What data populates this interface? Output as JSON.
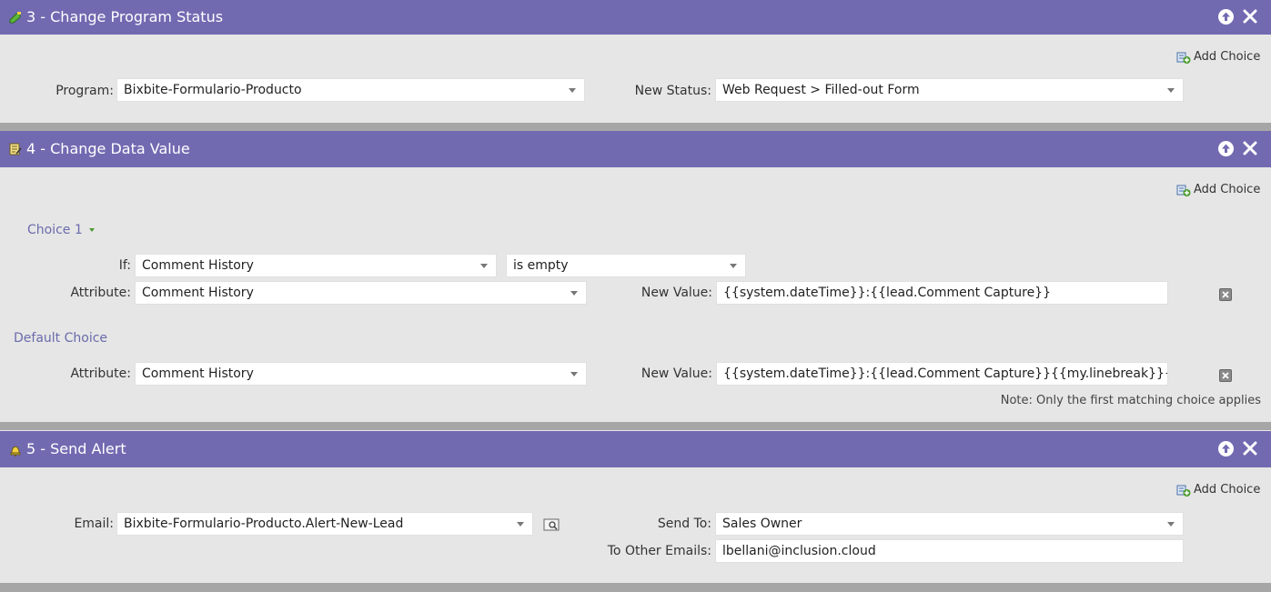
{
  "steps": [
    {
      "title": "3 - Change Program Status",
      "header_icon": "status-change-icon",
      "add_choice": "Add Choice",
      "program_label": "Program:",
      "program_value": "Bixbite-Formulario-Producto",
      "status_label": "New Status:",
      "status_value": "Web Request > Filled-out Form"
    },
    {
      "title": "4 - Change Data Value",
      "header_icon": "data-value-icon",
      "add_choice": "Add Choice",
      "choice1_label": "Choice 1",
      "if_label": "If:",
      "if_field": "Comment History",
      "if_operator": "is empty",
      "attr_label": "Attribute:",
      "choice1_attr": "Comment History",
      "newval_label": "New Value:",
      "choice1_value": "{{system.dateTime}}:{{lead.Comment Capture}}",
      "default_label": "Default Choice",
      "default_attr": "Comment History",
      "default_value": "{{system.dateTime}}:{{lead.Comment Capture}}{{my.linebreak}}{{lead.Com",
      "note": "Note: Only the first matching choice applies"
    },
    {
      "title": "5 - Send Alert",
      "header_icon": "alert-bell-icon",
      "add_choice": "Add Choice",
      "email_label": "Email:",
      "email_value": "Bixbite-Formulario-Producto.Alert-New-Lead",
      "sendto_label": "Send To:",
      "sendto_value": "Sales Owner",
      "other_label": "To Other Emails:",
      "other_value": "lbellani@inclusion.cloud"
    }
  ],
  "colors": {
    "header": "#716ab1",
    "panel": "#e6e6e6",
    "separator": "#a6a6a6",
    "link": "#6a6bab"
  }
}
